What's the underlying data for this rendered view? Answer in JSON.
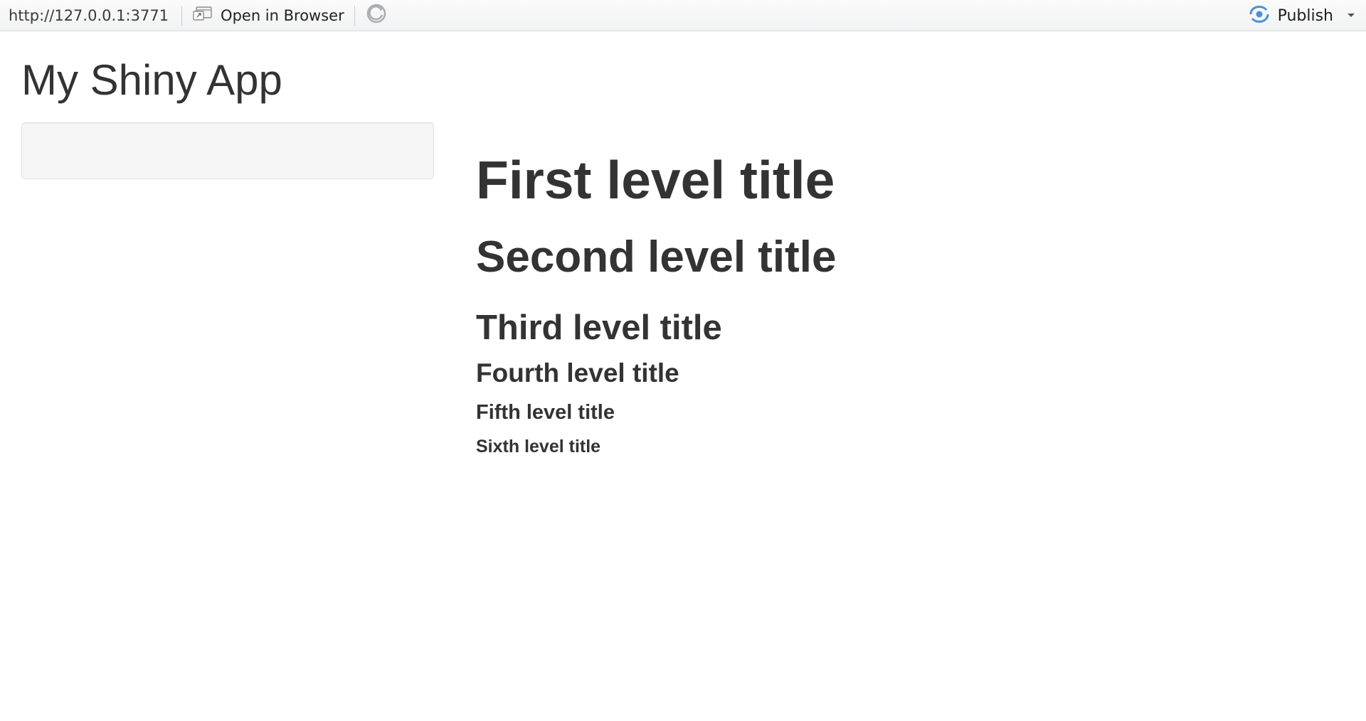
{
  "toolbar": {
    "url": "http://127.0.0.1:3771",
    "open_in_browser_label": "Open in Browser",
    "publish_label": "Publish",
    "icons": {
      "open_in_browser": "open-in-browser-icon",
      "refresh": "refresh-icon",
      "publish": "publish-icon",
      "dropdown": "caret-down-icon"
    },
    "publish_icon_color": "#4a90d9"
  },
  "app": {
    "title": "My Shiny App"
  },
  "main": {
    "headings": {
      "h1": "First level title",
      "h2": "Second level title",
      "h3": "Third level title",
      "h4": "Fourth level title",
      "h5": "Fifth level title",
      "h6": "Sixth level title"
    }
  }
}
